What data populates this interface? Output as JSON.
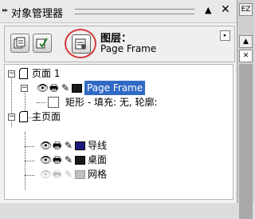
{
  "panel": {
    "title": "对象管理器",
    "collapse_icon": "▲",
    "close_icon": "✕"
  },
  "toolbar": {
    "layer_label": "图层：",
    "layer_name": "Page Frame",
    "menu_icon": "▸"
  },
  "tree": {
    "page1": {
      "label": "页面 1",
      "expander": "−"
    },
    "page_frame": {
      "label": "Page Frame",
      "color": "#1a1a1a"
    },
    "rect_object": {
      "label": "矩形 - 填充: 无, 轮廓: "
    },
    "master": {
      "label": "主页面",
      "expander": "−"
    },
    "layers": [
      {
        "label": "导线",
        "color": "#1a1a7a",
        "visible": true
      },
      {
        "label": "桌面",
        "color": "#1a1a1a",
        "visible": true
      },
      {
        "label": "网格",
        "color": "#c0c0c0",
        "visible": false
      }
    ]
  },
  "side": {
    "top_icon": "EZ"
  },
  "colors": {
    "selection": "#316ac5",
    "highlight_circle": "#d63b3b"
  }
}
